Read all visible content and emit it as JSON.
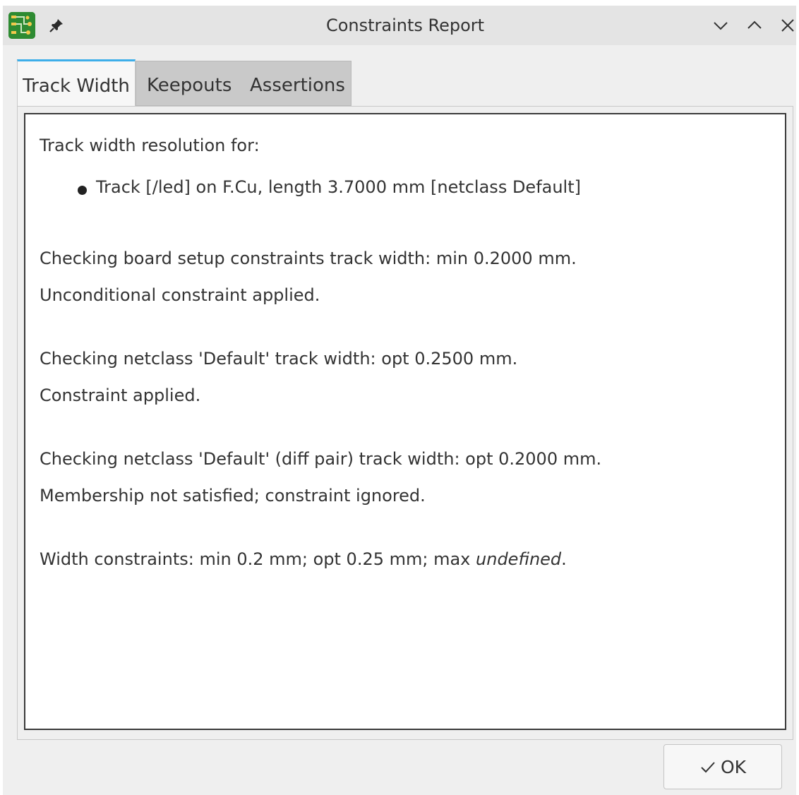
{
  "window": {
    "title": "Constraints Report",
    "icons": {
      "app": "pcb-board-icon",
      "pin": "pin-icon",
      "minimize": "chevron-down-icon",
      "maximize": "chevron-up-icon",
      "close": "close-icon"
    }
  },
  "tabs": [
    {
      "label": "Track Width",
      "active": true
    },
    {
      "label": "Keepouts",
      "active": false
    },
    {
      "label": "Assertions",
      "active": false
    }
  ],
  "report": {
    "heading": "Track width resolution for:",
    "item": "Track [/led] on F.Cu, length 3.7000 mm [netclass Default]",
    "lines": [
      "Checking board setup constraints track width: min 0.2000 mm.",
      "Unconditional constraint applied.",
      "Checking netclass 'Default' track width: opt 0.2500 mm.",
      "Constraint applied.",
      "Checking netclass 'Default' (diff pair) track width: opt 0.2000 mm.",
      "Membership not satisfied; constraint ignored."
    ],
    "summary_prefix": "Width constraints: min 0.2 mm; opt 0.25 mm; max ",
    "summary_undefined": "undefined",
    "summary_suffix": "."
  },
  "footer": {
    "ok_label": "OK",
    "ok_icon": "checkmark-icon"
  },
  "colors": {
    "accent": "#3daee9",
    "window_bg": "#efefef",
    "titlebar_bg": "#e4e4e4",
    "app_icon_green": "#2e8b32"
  }
}
